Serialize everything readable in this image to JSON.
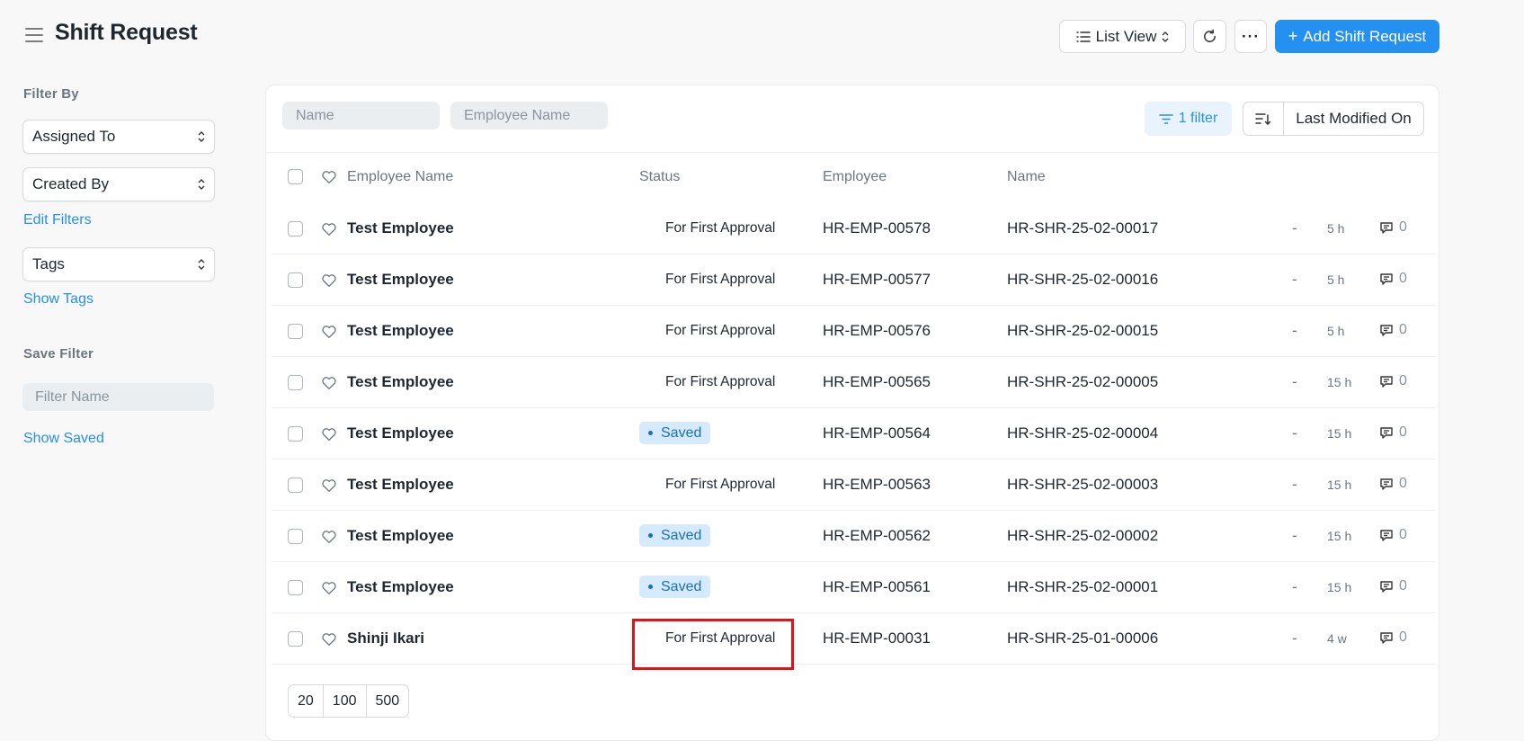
{
  "header": {
    "title": "Shift Request",
    "list_view_label": "List View",
    "more_label": "···",
    "add_label": "Add Shift Request"
  },
  "sidebar": {
    "filter_by_heading": "Filter By",
    "assigned_to": "Assigned To",
    "created_by": "Created By",
    "edit_filters": "Edit Filters",
    "tags": "Tags",
    "show_tags": "Show Tags",
    "save_filter_heading": "Save Filter",
    "filter_name_placeholder": "Filter Name",
    "show_saved": "Show Saved"
  },
  "list": {
    "name_placeholder": "Name",
    "employee_name_placeholder": "Employee Name",
    "filter_label": "1 filter",
    "sort_label": "Last Modified On",
    "columns": {
      "employee_name": "Employee Name",
      "status": "Status",
      "employee": "Employee",
      "name": "Name"
    },
    "rows": [
      {
        "employee_name": "Test Employee",
        "status": "For First Approval",
        "employee": "HR-EMP-00578",
        "name": "HR-SHR-25-02-00017",
        "dash": "-",
        "modified": "5 h",
        "comments": "0"
      },
      {
        "employee_name": "Test Employee",
        "status": "For First Approval",
        "employee": "HR-EMP-00577",
        "name": "HR-SHR-25-02-00016",
        "dash": "-",
        "modified": "5 h",
        "comments": "0"
      },
      {
        "employee_name": "Test Employee",
        "status": "For First Approval",
        "employee": "HR-EMP-00576",
        "name": "HR-SHR-25-02-00015",
        "dash": "-",
        "modified": "5 h",
        "comments": "0"
      },
      {
        "employee_name": "Test Employee",
        "status": "For First Approval",
        "employee": "HR-EMP-00565",
        "name": "HR-SHR-25-02-00005",
        "dash": "-",
        "modified": "15 h",
        "comments": "0"
      },
      {
        "employee_name": "Test Employee",
        "status": "Saved",
        "employee": "HR-EMP-00564",
        "name": "HR-SHR-25-02-00004",
        "dash": "-",
        "modified": "15 h",
        "comments": "0"
      },
      {
        "employee_name": "Test Employee",
        "status": "For First Approval",
        "employee": "HR-EMP-00563",
        "name": "HR-SHR-25-02-00003",
        "dash": "-",
        "modified": "15 h",
        "comments": "0"
      },
      {
        "employee_name": "Test Employee",
        "status": "Saved",
        "employee": "HR-EMP-00562",
        "name": "HR-SHR-25-02-00002",
        "dash": "-",
        "modified": "15 h",
        "comments": "0"
      },
      {
        "employee_name": "Test Employee",
        "status": "Saved",
        "employee": "HR-EMP-00561",
        "name": "HR-SHR-25-02-00001",
        "dash": "-",
        "modified": "15 h",
        "comments": "0"
      },
      {
        "employee_name": "Shinji Ikari",
        "status": "For First Approval",
        "employee": "HR-EMP-00031",
        "name": "HR-SHR-25-01-00006",
        "dash": "-",
        "modified": "4 w",
        "comments": "0"
      }
    ],
    "page_sizes": [
      "20",
      "100",
      "500"
    ]
  },
  "colors": {
    "primary": "#2490ef",
    "saved_pill_bg": "#d5ebfd",
    "highlight": "#e01414"
  }
}
